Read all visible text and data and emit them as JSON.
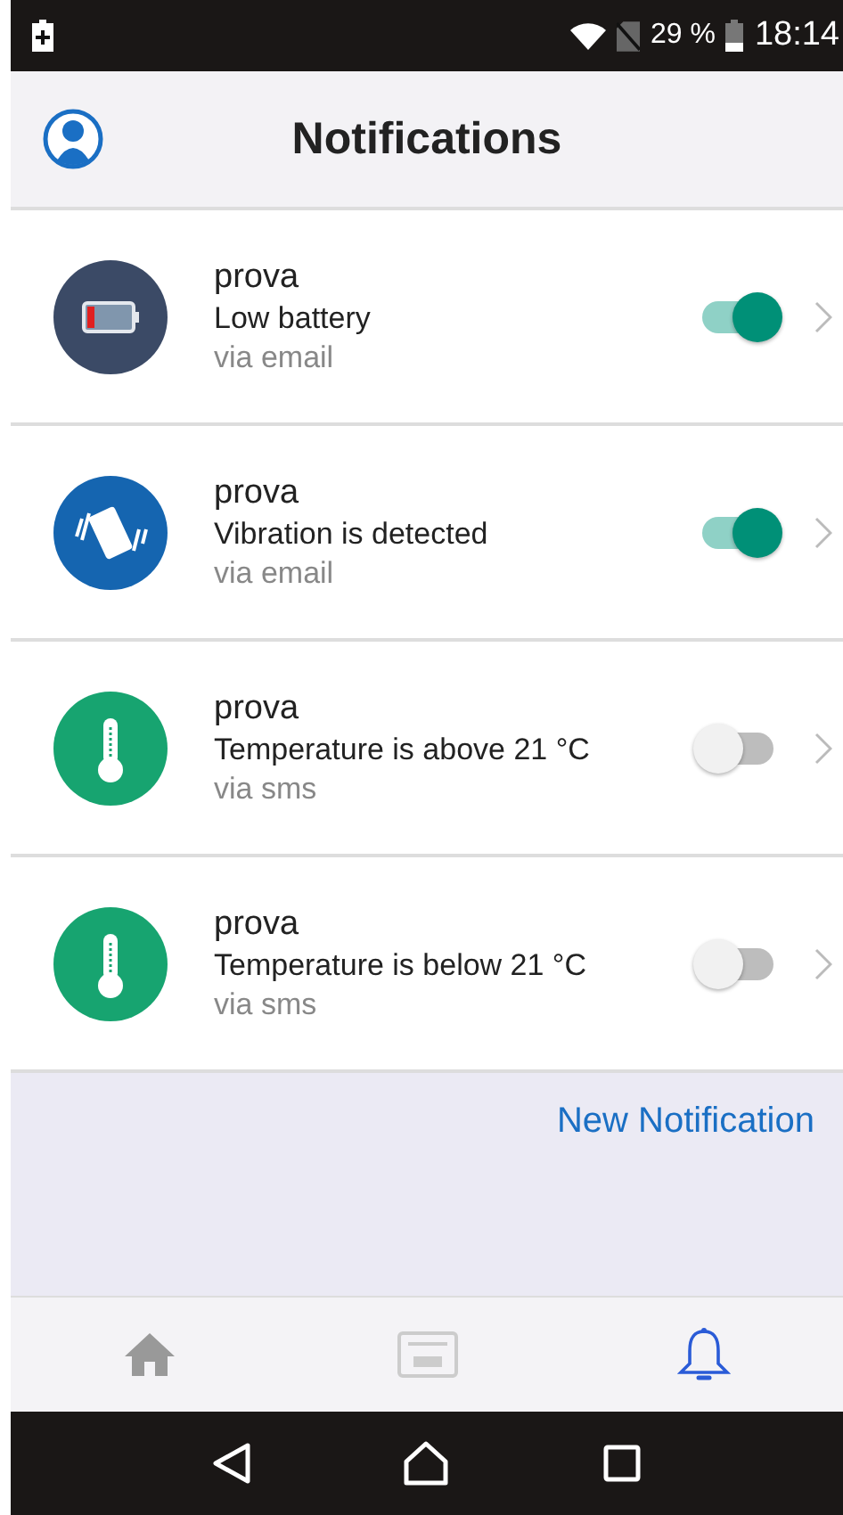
{
  "status_bar": {
    "battery_percent": "29 %",
    "time": "18:14"
  },
  "header": {
    "title": "Notifications"
  },
  "notifications": [
    {
      "kind": "battery",
      "color": "#3b4a66",
      "name": "prova",
      "event": "Low battery",
      "channel": "via email",
      "on": true
    },
    {
      "kind": "vibration",
      "color": "#1565b0",
      "name": "prova",
      "event": "Vibration is detected",
      "channel": "via email",
      "on": true
    },
    {
      "kind": "thermometer",
      "color": "#17a470",
      "name": "prova",
      "event": "Temperature is above 21 °C",
      "channel": "via sms",
      "on": false
    },
    {
      "kind": "thermometer",
      "color": "#17a470",
      "name": "prova",
      "event": "Temperature is below 21 °C",
      "channel": "via sms",
      "on": false
    }
  ],
  "new_notification_link": "New Notification",
  "tabs": [
    {
      "kind": "home",
      "selected": false
    },
    {
      "kind": "dashboard",
      "selected": false
    },
    {
      "kind": "bell",
      "selected": true
    }
  ]
}
